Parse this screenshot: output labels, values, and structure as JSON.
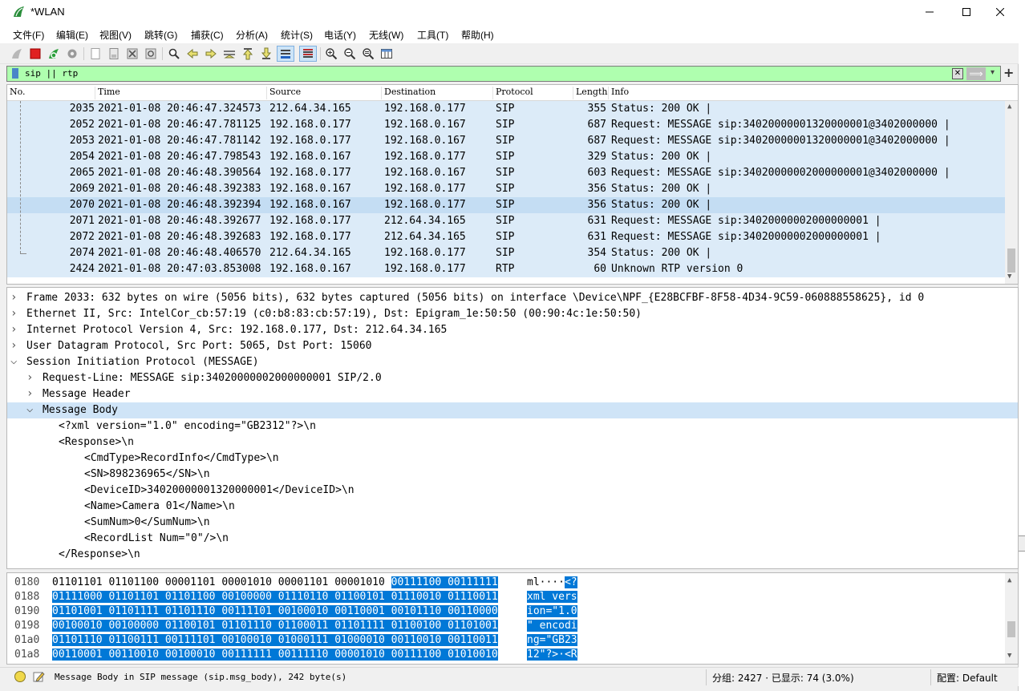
{
  "window": {
    "title": "*WLAN"
  },
  "menu": [
    "文件(F)",
    "编辑(E)",
    "视图(V)",
    "跳转(G)",
    "捕获(C)",
    "分析(A)",
    "统计(S)",
    "电话(Y)",
    "无线(W)",
    "工具(T)",
    "帮助(H)"
  ],
  "filter": {
    "value": "sip || rtp",
    "apply_arrow": "⟹",
    "dropdown_arrow": "▾",
    "add_symbol": "+"
  },
  "columns": [
    "No.",
    "Time",
    "Source",
    "Destination",
    "Protocol",
    "Length",
    "Info"
  ],
  "packets": [
    {
      "no": "2035",
      "time": "2021-01-08 20:46:47.324573",
      "src": "212.64.34.165",
      "dst": "192.168.0.177",
      "proto": "SIP",
      "len": "355",
      "info": "Status: 200 OK |"
    },
    {
      "no": "2052",
      "time": "2021-01-08 20:46:47.781125",
      "src": "192.168.0.177",
      "dst": "192.168.0.167",
      "proto": "SIP",
      "len": "687",
      "info": "Request: MESSAGE sip:34020000001320000001@3402000000 |"
    },
    {
      "no": "2053",
      "time": "2021-01-08 20:46:47.781142",
      "src": "192.168.0.177",
      "dst": "192.168.0.167",
      "proto": "SIP",
      "len": "687",
      "info": "Request: MESSAGE sip:34020000001320000001@3402000000 |"
    },
    {
      "no": "2054",
      "time": "2021-01-08 20:46:47.798543",
      "src": "192.168.0.167",
      "dst": "192.168.0.177",
      "proto": "SIP",
      "len": "329",
      "info": "Status: 200 OK |"
    },
    {
      "no": "2065",
      "time": "2021-01-08 20:46:48.390564",
      "src": "192.168.0.177",
      "dst": "192.168.0.167",
      "proto": "SIP",
      "len": "603",
      "info": "Request: MESSAGE sip:34020000002000000001@3402000000 |"
    },
    {
      "no": "2069",
      "time": "2021-01-08 20:46:48.392383",
      "src": "192.168.0.167",
      "dst": "192.168.0.177",
      "proto": "SIP",
      "len": "356",
      "info": "Status: 200 OK |"
    },
    {
      "no": "2070",
      "time": "2021-01-08 20:46:48.392394",
      "src": "192.168.0.167",
      "dst": "192.168.0.177",
      "proto": "SIP",
      "len": "356",
      "info": "Status: 200 OK |"
    },
    {
      "no": "2071",
      "time": "2021-01-08 20:46:48.392677",
      "src": "192.168.0.177",
      "dst": "212.64.34.165",
      "proto": "SIP",
      "len": "631",
      "info": "Request: MESSAGE sip:34020000002000000001 |"
    },
    {
      "no": "2072",
      "time": "2021-01-08 20:46:48.392683",
      "src": "192.168.0.177",
      "dst": "212.64.34.165",
      "proto": "SIP",
      "len": "631",
      "info": "Request: MESSAGE sip:34020000002000000001 |"
    },
    {
      "no": "2074",
      "time": "2021-01-08 20:46:48.406570",
      "src": "212.64.34.165",
      "dst": "192.168.0.177",
      "proto": "SIP",
      "len": "354",
      "info": "Status: 200 OK |"
    },
    {
      "no": "2424",
      "time": "2021-01-08 20:47:03.853008",
      "src": "192.168.0.167",
      "dst": "192.168.0.177",
      "proto": "RTP",
      "len": "60",
      "info": "Unknown RTP version 0"
    }
  ],
  "details": [
    {
      "arrow": ">",
      "text": "Frame 2033: 632 bytes on wire (5056 bits), 632 bytes captured (5056 bits) on interface \\Device\\NPF_{E28BCFBF-8F58-4D34-9C59-060888558625}, id 0"
    },
    {
      "arrow": ">",
      "text": "Ethernet II, Src: IntelCor_cb:57:19 (c0:b8:83:cb:57:19), Dst: Epigram_1e:50:50 (00:90:4c:1e:50:50)"
    },
    {
      "arrow": ">",
      "text": "Internet Protocol Version 4, Src: 192.168.0.177, Dst: 212.64.34.165"
    },
    {
      "arrow": ">",
      "text": "User Datagram Protocol, Src Port: 5065, Dst Port: 15060"
    },
    {
      "arrow": "v",
      "text": "Session Initiation Protocol (MESSAGE)"
    },
    {
      "arrow": ">",
      "text": "Request-Line: MESSAGE sip:34020000002000000001 SIP/2.0"
    },
    {
      "arrow": ">",
      "text": "Message Header"
    },
    {
      "arrow": "v",
      "text": "Message Body"
    },
    {
      "arrow": "",
      "text": "<?xml version=\"1.0\" encoding=\"GB2312\"?>\\n"
    },
    {
      "arrow": "",
      "text": "<Response>\\n"
    },
    {
      "arrow": "",
      "text": "<CmdType>RecordInfo</CmdType>\\n"
    },
    {
      "arrow": "",
      "text": "<SN>898236965</SN>\\n"
    },
    {
      "arrow": "",
      "text": "<DeviceID>34020000001320000001</DeviceID>\\n"
    },
    {
      "arrow": "",
      "text": "<Name>Camera 01</Name>\\n"
    },
    {
      "arrow": "",
      "text": "<SumNum>0</SumNum>\\n"
    },
    {
      "arrow": "",
      "text": "<RecordList Num=\"0\"/>\\n"
    },
    {
      "arrow": "",
      "text": "</Response>\\n"
    }
  ],
  "bytes": [
    {
      "off": "0180",
      "hex_plain": "01101101 01101100 00001101 00001010 00001101 00001010 ",
      "hex_hl": "00111100 00111111",
      "asc_plain": "ml····",
      "asc_hl": "<?"
    },
    {
      "off": "0188",
      "hex_plain": "",
      "hex_hl": "01111000 01101101 01101100 00100000 01110110 01100101 01110010 01110011",
      "asc_plain": "",
      "asc_hl": "xml vers"
    },
    {
      "off": "0190",
      "hex_plain": "",
      "hex_hl": "01101001 01101111 01101110 00111101 00100010 00110001 00101110 00110000",
      "asc_plain": "",
      "asc_hl": "ion=\"1.0"
    },
    {
      "off": "0198",
      "hex_plain": "",
      "hex_hl": "00100010 00100000 01100101 01101110 01100011 01101111 01100100 01101001",
      "asc_plain": "",
      "asc_hl": "\" encodi"
    },
    {
      "off": "01a0",
      "hex_plain": "",
      "hex_hl": "01101110 01100111 00111101 00100010 01000111 01000010 00110010 00110011",
      "asc_plain": "",
      "asc_hl": "ng=\"GB23"
    },
    {
      "off": "01a8",
      "hex_plain": "",
      "hex_hl": "00110001 00110010 00100010 00111111 00111110 00001010 00111100 01010010",
      "asc_plain": "",
      "asc_hl": "12\"?>·<R"
    }
  ],
  "status": {
    "field": "Message Body in SIP message (sip.msg_body), 242 byte(s)",
    "packets": "分组: 2427 · 已显示: 74 (3.0%)",
    "profile": "配置: Default"
  },
  "colors": {
    "filter_valid": "#afffaf",
    "row_bg": "#dcebf8",
    "row_selected": "#c4ddf3",
    "byte_highlight": "#0078d7"
  }
}
